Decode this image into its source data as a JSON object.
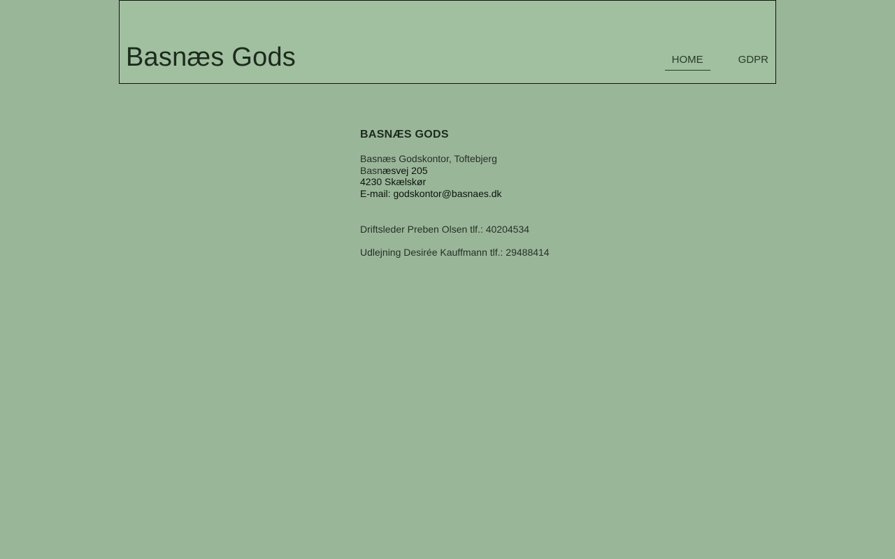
{
  "header": {
    "site_title": "Basnæs Gods",
    "nav": [
      {
        "label": "HOME",
        "active": true
      },
      {
        "label": "GDPR",
        "active": false
      }
    ]
  },
  "content": {
    "heading": "BASNÆS GODS",
    "address": {
      "line1": "Basnæs Godskontor, Toftebjerg",
      "line2_part1": "Basn",
      "line2_part2": "æsvej 205",
      "line3": "4230 Skælskør",
      "line4": "E-mail: godskontor@basnaes.dk"
    },
    "contacts": [
      "Driftsleder Preben Olsen tlf.: 40204534",
      "Udlejning Desirée Kauffmann tlf.: 29488414"
    ]
  },
  "colors": {
    "page_background": "#9ab699",
    "header_background": "#a0c09f",
    "text": "#253025"
  }
}
